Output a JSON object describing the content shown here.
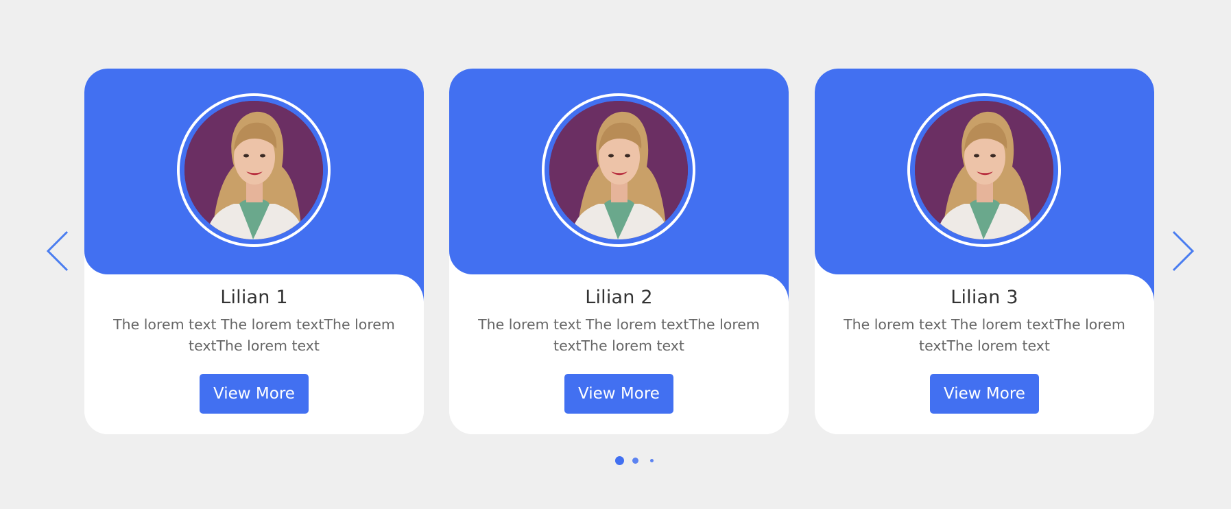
{
  "theme": {
    "accent": "#4270f1",
    "background": "#efefef",
    "card_background": "#ffffff",
    "photo_background": "#6b2f63"
  },
  "slider": {
    "prev_icon": "chevron-left-icon",
    "next_icon": "chevron-right-icon",
    "cards": [
      {
        "name": "Lilian 1",
        "text": "The lorem text The lorem textThe lorem textThe lorem text",
        "button_label": "View More",
        "avatar_icon": "profile-photo"
      },
      {
        "name": "Lilian 2",
        "text": "The lorem text The lorem textThe lorem textThe lorem text",
        "button_label": "View More",
        "avatar_icon": "profile-photo"
      },
      {
        "name": "Lilian 3",
        "text": "The lorem text The lorem textThe lorem textThe lorem text",
        "button_label": "View More",
        "avatar_icon": "profile-photo"
      }
    ],
    "pagination": {
      "count": 3,
      "active_index": 0
    }
  }
}
